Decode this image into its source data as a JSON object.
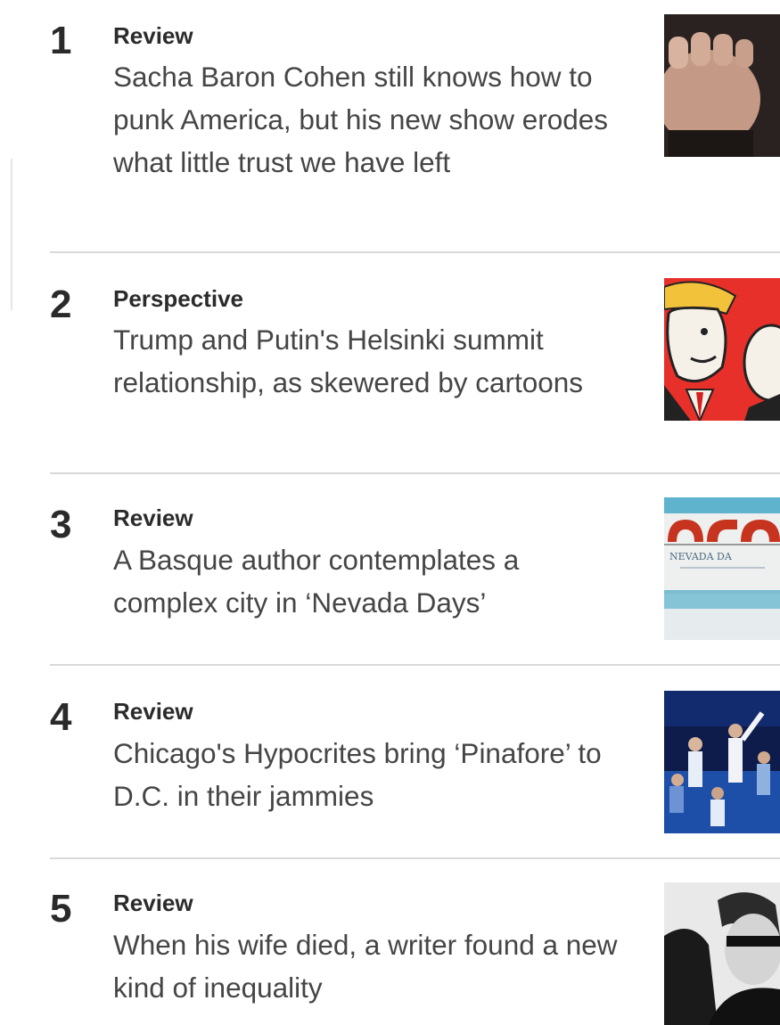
{
  "most_read": {
    "items": [
      {
        "rank": "1",
        "kicker": "Review",
        "headline": "Sacha Baron Cohen still knows how to punk America, but his new show erodes what little trust we have left",
        "thumbnail_icon": "fist-photo-icon"
      },
      {
        "rank": "2",
        "kicker": "Perspective",
        "headline": "Trump and Putin's Helsinki summit relationship, as skewered by cartoons",
        "thumbnail_icon": "cartoon-illustration-icon"
      },
      {
        "rank": "3",
        "kicker": "Review",
        "headline": "A Basque author contemplates a complex city in ‘Nevada Days’",
        "thumbnail_icon": "book-cover-icon",
        "thumbnail_text": "NEVADA DA"
      },
      {
        "rank": "4",
        "kicker": "Review",
        "headline": "Chicago's Hypocrites bring ‘Pinafore’ to D.C. in their jammies",
        "thumbnail_icon": "stage-performance-photo-icon"
      },
      {
        "rank": "5",
        "kicker": "Review",
        "headline": "When his wife died, a writer found a new kind of inequality",
        "thumbnail_icon": "author-portrait-photo-icon"
      }
    ]
  }
}
